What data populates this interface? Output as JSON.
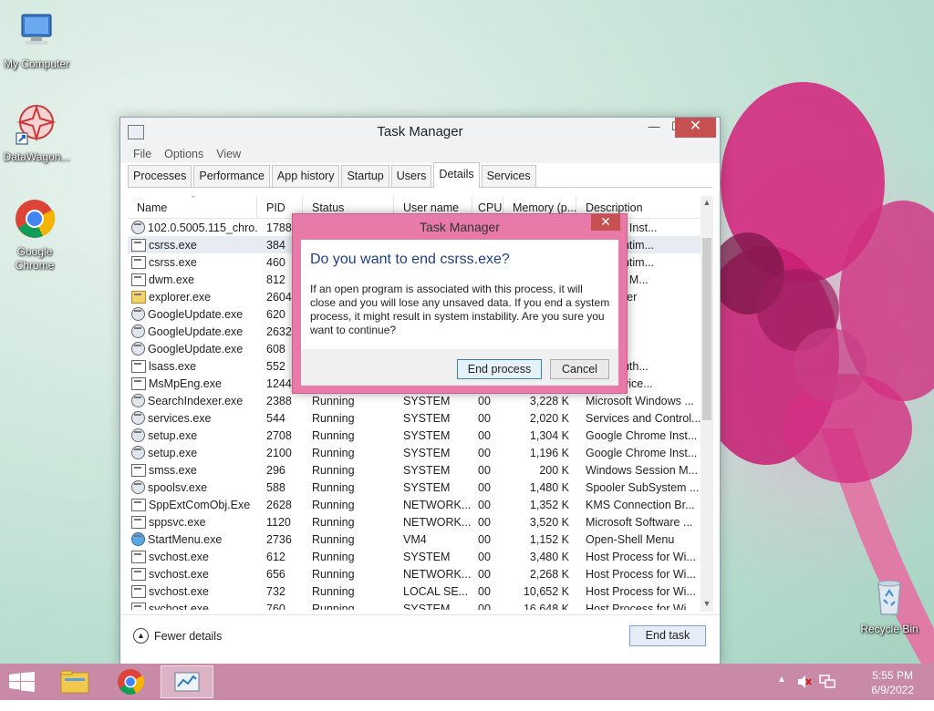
{
  "desktop": {
    "icons": [
      {
        "label": "My Computer"
      },
      {
        "label": "DataWagon..."
      },
      {
        "label_line1": "Google",
        "label_line2": "Chrome"
      },
      {
        "label": "Recycle Bin"
      }
    ]
  },
  "task_manager": {
    "title": "Task Manager",
    "menu": [
      "File",
      "Options",
      "View"
    ],
    "tabs": [
      "Processes",
      "Performance",
      "App history",
      "Startup",
      "Users",
      "Details",
      "Services"
    ],
    "active_tab": "Details",
    "columns": [
      "Name",
      "PID",
      "Status",
      "User name",
      "CPU",
      "Memory (p...",
      "Description"
    ],
    "rows": [
      {
        "name": "102.0.5005.115_chro...",
        "pid": "1788",
        "status": "",
        "user": "",
        "cpu": "",
        "mem": "",
        "desc": "Chrome Inst..."
      },
      {
        "name": "csrss.exe",
        "pid": "384",
        "status": "",
        "user": "",
        "cpu": "",
        "mem": "",
        "desc": "rver Runtim..."
      },
      {
        "name": "csrss.exe",
        "pid": "460",
        "status": "",
        "user": "",
        "cpu": "",
        "mem": "",
        "desc": "rver Runtim..."
      },
      {
        "name": "dwm.exe",
        "pid": "812",
        "status": "",
        "user": "",
        "cpu": "",
        "mem": "",
        "desc": "Window M..."
      },
      {
        "name": "explorer.exe",
        "pid": "2604",
        "status": "",
        "user": "",
        "cpu": "",
        "mem": "",
        "desc": "s Explorer"
      },
      {
        "name": "GoogleUpdate.exe",
        "pid": "620",
        "status": "",
        "user": "",
        "cpu": "",
        "mem": "",
        "desc": "nstaller"
      },
      {
        "name": "GoogleUpdate.exe",
        "pid": "2632",
        "status": "",
        "user": "",
        "cpu": "",
        "mem": "",
        "desc": "nstaller"
      },
      {
        "name": "GoogleUpdate.exe",
        "pid": "608",
        "status": "",
        "user": "",
        "cpu": "",
        "mem": "",
        "desc": "nstaller"
      },
      {
        "name": "lsass.exe",
        "pid": "552",
        "status": "",
        "user": "",
        "cpu": "",
        "mem": "",
        "desc": "curity Auth..."
      },
      {
        "name": "MsMpEng.exe",
        "pid": "1244",
        "status": "",
        "user": "",
        "cpu": "",
        "mem": "",
        "desc": "are Service..."
      },
      {
        "name": "SearchIndexer.exe",
        "pid": "2388",
        "status": "Running",
        "user": "SYSTEM",
        "cpu": "00",
        "mem": "3,228 K",
        "desc": "Microsoft Windows ..."
      },
      {
        "name": "services.exe",
        "pid": "544",
        "status": "Running",
        "user": "SYSTEM",
        "cpu": "00",
        "mem": "2,020 K",
        "desc": "Services and Control..."
      },
      {
        "name": "setup.exe",
        "pid": "2708",
        "status": "Running",
        "user": "SYSTEM",
        "cpu": "00",
        "mem": "1,304 K",
        "desc": "Google Chrome Inst..."
      },
      {
        "name": "setup.exe",
        "pid": "2100",
        "status": "Running",
        "user": "SYSTEM",
        "cpu": "00",
        "mem": "1,196 K",
        "desc": "Google Chrome Inst..."
      },
      {
        "name": "smss.exe",
        "pid": "296",
        "status": "Running",
        "user": "SYSTEM",
        "cpu": "00",
        "mem": "200 K",
        "desc": "Windows Session M..."
      },
      {
        "name": "spoolsv.exe",
        "pid": "588",
        "status": "Running",
        "user": "SYSTEM",
        "cpu": "00",
        "mem": "1,480 K",
        "desc": "Spooler SubSystem ..."
      },
      {
        "name": "SppExtComObj.Exe",
        "pid": "2628",
        "status": "Running",
        "user": "NETWORK...",
        "cpu": "00",
        "mem": "1,352 K",
        "desc": "KMS Connection Br..."
      },
      {
        "name": "sppsvc.exe",
        "pid": "1120",
        "status": "Running",
        "user": "NETWORK...",
        "cpu": "00",
        "mem": "3,520 K",
        "desc": "Microsoft Software ..."
      },
      {
        "name": "StartMenu.exe",
        "pid": "2736",
        "status": "Running",
        "user": "VM4",
        "cpu": "00",
        "mem": "1,152 K",
        "desc": "Open-Shell Menu"
      },
      {
        "name": "svchost.exe",
        "pid": "612",
        "status": "Running",
        "user": "SYSTEM",
        "cpu": "00",
        "mem": "3,480 K",
        "desc": "Host Process for Wi..."
      },
      {
        "name": "svchost.exe",
        "pid": "656",
        "status": "Running",
        "user": "NETWORK...",
        "cpu": "00",
        "mem": "2,268 K",
        "desc": "Host Process for Wi..."
      },
      {
        "name": "svchost.exe",
        "pid": "732",
        "status": "Running",
        "user": "LOCAL SE...",
        "cpu": "00",
        "mem": "10,652 K",
        "desc": "Host Process for Wi..."
      },
      {
        "name": "svchost.exe",
        "pid": "760",
        "status": "Running",
        "user": "SYSTEM",
        "cpu": "00",
        "mem": "16,648 K",
        "desc": "Host Process for Wi..."
      }
    ],
    "fewer_details": "Fewer details",
    "end_task": "End task"
  },
  "dialog": {
    "title": "Task Manager",
    "heading": "Do you want to end csrss.exe?",
    "body": "If an open program is associated with this process, it will close and you will lose any unsaved data. If you end a system process, it might result in system instability. Are you sure you want to continue?",
    "end_process": "End process",
    "cancel": "Cancel"
  },
  "taskbar": {
    "time": "5:55 PM",
    "date": "6/9/2022"
  }
}
